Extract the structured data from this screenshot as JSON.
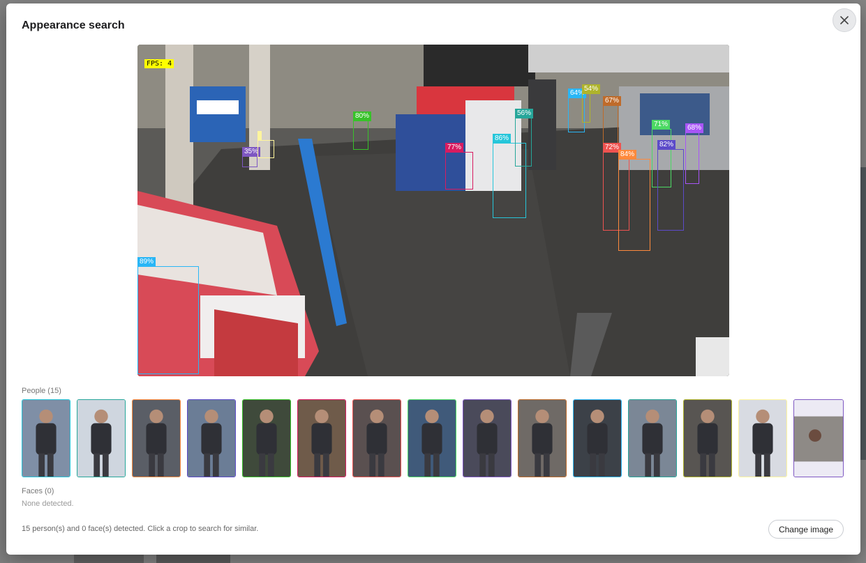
{
  "modal": {
    "title": "Appearance search",
    "close_icon": "close-icon"
  },
  "frame": {
    "fps_label": "FPS: 4",
    "detections": [
      {
        "label": "89%",
        "color": "#29b6f6"
      },
      {
        "label": "80%",
        "color": "#38c22a"
      },
      {
        "label": "35%",
        "color": "#7e57c2"
      },
      {
        "label": "",
        "color": "#fff59d"
      },
      {
        "label": "77%",
        "color": "#d81b60"
      },
      {
        "label": "86%",
        "color": "#26c6da"
      },
      {
        "label": "56%",
        "color": "#26a69a"
      },
      {
        "label": "64%",
        "color": "#29b6f6"
      },
      {
        "label": "54%",
        "color": "#afb42b"
      },
      {
        "label": "67%",
        "color": "#bf6b2a"
      },
      {
        "label": "72%",
        "color": "#ef5350"
      },
      {
        "label": "84%",
        "color": "#ff8a3d"
      },
      {
        "label": "71%",
        "color": "#4cd964"
      },
      {
        "label": "82%",
        "color": "#5c4bc9"
      },
      {
        "label": "68%",
        "color": "#a855f7"
      }
    ]
  },
  "people": {
    "label": "People (15)",
    "crops": [
      {
        "color": "#26c6da"
      },
      {
        "color": "#26a69a"
      },
      {
        "color": "#ff8a3d"
      },
      {
        "color": "#5c4bc9"
      },
      {
        "color": "#38c22a"
      },
      {
        "color": "#d81b60"
      },
      {
        "color": "#ef5350"
      },
      {
        "color": "#4cd964"
      },
      {
        "color": "#7e57c2"
      },
      {
        "color": "#bf6b2a"
      },
      {
        "color": "#29b6f6"
      },
      {
        "color": "#26a69a"
      },
      {
        "color": "#afb42b"
      },
      {
        "color": "#fff59d"
      },
      {
        "color": "#7e57c2"
      }
    ]
  },
  "faces": {
    "label": "Faces (0)",
    "empty_text": "None detected."
  },
  "footer": {
    "status": "15 person(s) and 0 face(s) detected. Click a crop to search for similar.",
    "change_image_label": "Change image"
  }
}
